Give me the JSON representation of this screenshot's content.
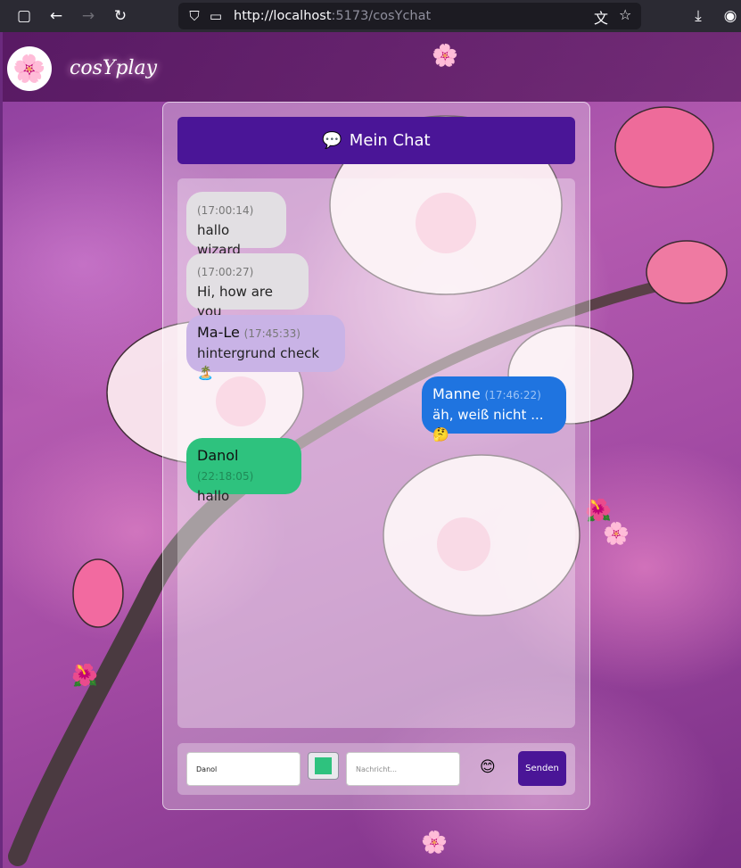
{
  "browser": {
    "url_host": "http://localhost",
    "url_rest": ":5173/cosYchat",
    "icons": [
      "sidebar-icon",
      "back-icon",
      "forward-icon",
      "reload-icon",
      "shield-icon",
      "page-icon",
      "translate-icon",
      "star-icon",
      "download-icon",
      "account-icon"
    ]
  },
  "app": {
    "brand": "cosYplay",
    "chat_title": "Mein Chat",
    "chat_title_icon": "💬"
  },
  "messages": [
    {
      "sender": "",
      "time": "(17:00:14)",
      "text": "hallo wizard",
      "color": "#e2dfe3",
      "align": "left"
    },
    {
      "sender": "",
      "time": "(17:00:27)",
      "text": "Hi, how are you",
      "color": "#e2dfe3",
      "align": "left"
    },
    {
      "sender": "Ma-Le",
      "time": "(17:45:33)",
      "text": "hintergrund check🏝️",
      "color": "#c9b3e6",
      "align": "left"
    },
    {
      "sender": "Manne",
      "time": "(17:46:22)",
      "text": "äh, weiß nicht ... 🤔",
      "color": "#1f74e0",
      "align": "right"
    },
    {
      "sender": "Danol",
      "time": "(22:18:05)",
      "text": "hallo",
      "color": "#2ec27e",
      "align": "left"
    }
  ],
  "composer": {
    "name_value": "Danol",
    "color_value": "#2ec27e",
    "message_placeholder": "Nachricht...",
    "emoji": "😊",
    "send_label": "Senden"
  },
  "colors": {
    "accent": "#4a1597",
    "header": "#5a1a68"
  }
}
